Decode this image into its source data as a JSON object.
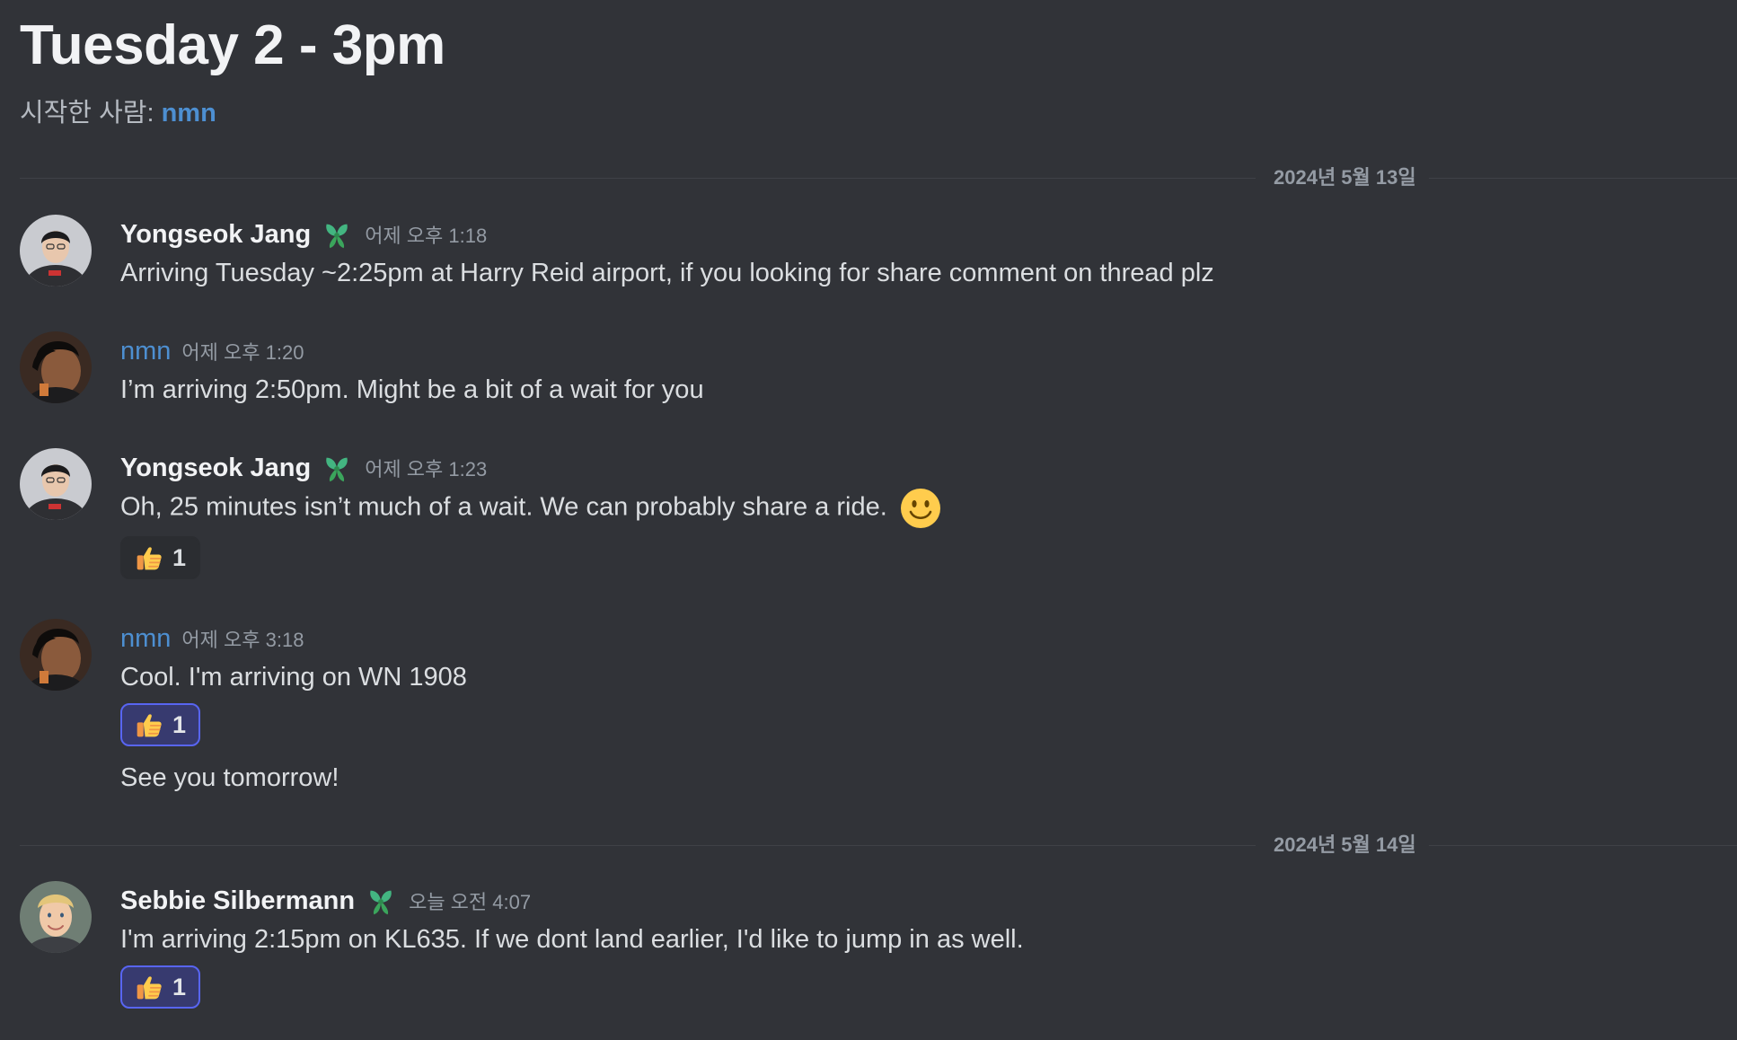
{
  "thread": {
    "title": "Tuesday 2 - 3pm",
    "started_by_label": "시작한 사람: ",
    "started_by_user": "nmn"
  },
  "dividers": [
    {
      "label": "2024년 5월 13일"
    },
    {
      "label": "2024년 5월 14일"
    }
  ],
  "messages": [
    {
      "author": "Yongseok Jang",
      "timestamp": "어제 오후 1:18",
      "text": "Arriving Tuesday ~2:25pm at Harry Reid airport, if you looking for share comment on thread plz"
    },
    {
      "author": "nmn",
      "timestamp": "어제 오후 1:20",
      "text": "I’m arriving 2:50pm. Might be a bit of a wait for you"
    },
    {
      "author": "Yongseok Jang",
      "timestamp": "어제 오후 1:23",
      "text": "Oh, 25 minutes isn’t much of a wait. We can probably share a ride.",
      "reaction": {
        "emoji": "thumbs-up",
        "count": "1"
      }
    },
    {
      "author": "nmn",
      "timestamp": "어제 오후 3:18",
      "text": "Cool. I'm arriving on WN 1908",
      "reaction": {
        "emoji": "thumbs-up",
        "count": "1"
      },
      "followup": "See you tomorrow!"
    },
    {
      "author": "Sebbie Silbermann",
      "timestamp": "오늘 오전 4:07",
      "text": "I'm arriving 2:15pm on KL635. If we dont land earlier, I'd like to jump in as well.",
      "reaction": {
        "emoji": "thumbs-up",
        "count": "1"
      }
    }
  ],
  "colors": {
    "background": "#313338",
    "link_user": "#4d8fd1",
    "reaction_active_border": "#5865f2",
    "badge_green": "#3ba55c"
  },
  "icons": [
    "leaf-badge-icon",
    "thumbs-up-icon",
    "smile-emoji-icon"
  ]
}
